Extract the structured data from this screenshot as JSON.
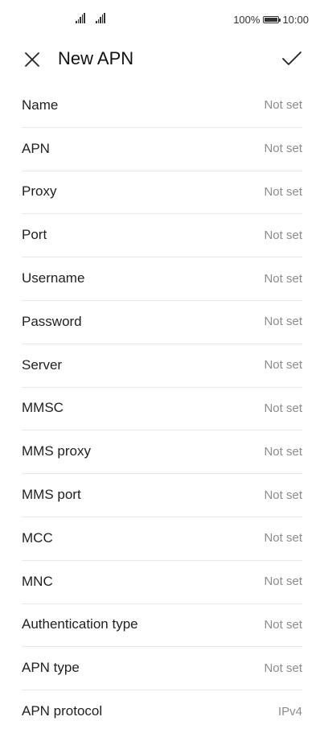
{
  "status_bar": {
    "battery_text": "100%",
    "time": "10:00"
  },
  "app_bar": {
    "title": "New APN",
    "close_icon": "close-icon",
    "confirm_icon": "checkmark-icon"
  },
  "fields": [
    {
      "label": "Name",
      "value": "Not set"
    },
    {
      "label": "APN",
      "value": "Not set"
    },
    {
      "label": "Proxy",
      "value": "Not set"
    },
    {
      "label": "Port",
      "value": "Not set"
    },
    {
      "label": "Username",
      "value": "Not set"
    },
    {
      "label": "Password",
      "value": "Not set"
    },
    {
      "label": "Server",
      "value": "Not set"
    },
    {
      "label": "MMSC",
      "value": "Not set"
    },
    {
      "label": "MMS proxy",
      "value": "Not set"
    },
    {
      "label": "MMS port",
      "value": "Not set"
    },
    {
      "label": "MCC",
      "value": "Not set"
    },
    {
      "label": "MNC",
      "value": "Not set"
    },
    {
      "label": "Authentication type",
      "value": "Not set"
    },
    {
      "label": "APN type",
      "value": "Not set"
    },
    {
      "label": "APN protocol",
      "value": "IPv4"
    }
  ]
}
